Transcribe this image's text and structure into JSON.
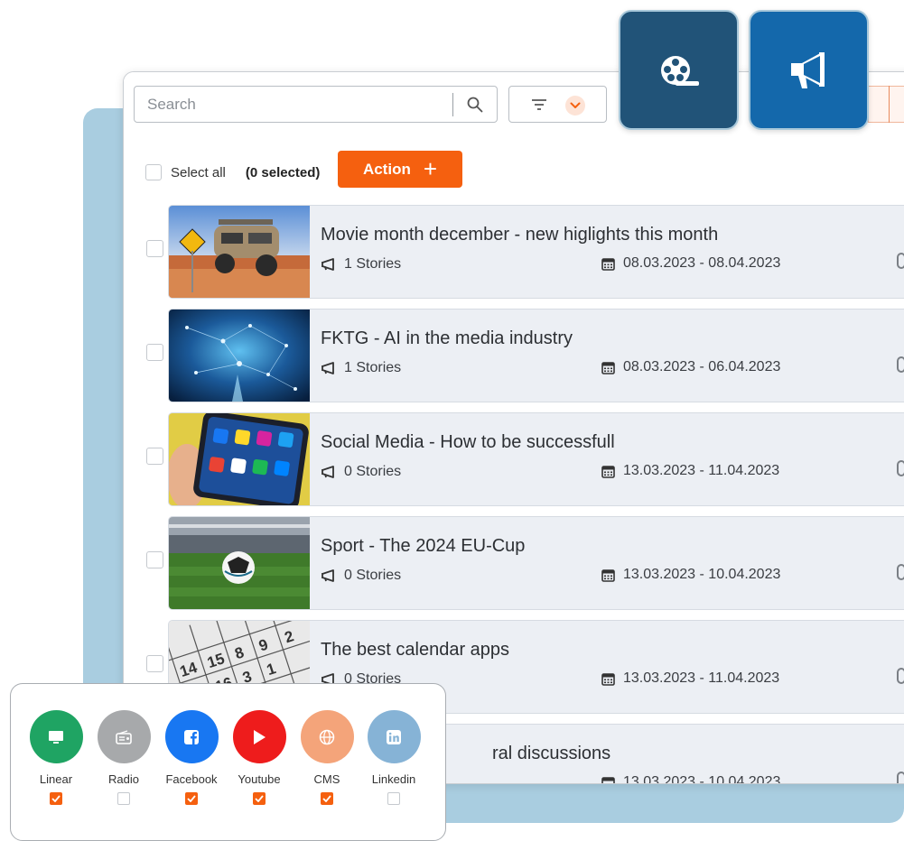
{
  "search": {
    "placeholder": "Search"
  },
  "selection": {
    "select_all_label": "Select all",
    "selected_count_text": "(0 selected)"
  },
  "action_button": {
    "label": "Action"
  },
  "big_buttons": [
    {
      "name": "film-button",
      "icon": "film-reel-icon",
      "color": "#215378"
    },
    {
      "name": "campaign-button",
      "icon": "megaphone-icon",
      "color": "#1468ab"
    }
  ],
  "items": [
    {
      "title": "Movie month december - new higlights this month",
      "stories": "1 Stories",
      "dates": "08.03.2023 - 08.04.2023",
      "thumb": "desert-vehicle"
    },
    {
      "title": "FKTG - AI in the media industry",
      "stories": "1 Stories",
      "dates": "08.03.2023 - 06.04.2023",
      "thumb": "ai-network"
    },
    {
      "title": "Social Media - How to be successfull",
      "stories": "0 Stories",
      "dates": "13.03.2023 - 11.04.2023",
      "thumb": "phone-apps"
    },
    {
      "title": "Sport - The 2024 EU-Cup",
      "stories": "0 Stories",
      "dates": "13.03.2023 - 10.04.2023",
      "thumb": "stadium-ball"
    },
    {
      "title": "The best calendar apps",
      "stories": "0 Stories",
      "dates": "13.03.2023 - 11.04.2023",
      "thumb": "calendar"
    },
    {
      "title": "ral discussions",
      "stories": "",
      "dates": "13.03.2023 - 10.04.2023",
      "thumb": ""
    }
  ],
  "channels": [
    {
      "label": "Linear",
      "icon": "monitor-icon",
      "color": "#1fa463",
      "checked": true
    },
    {
      "label": "Radio",
      "icon": "radio-icon",
      "color": "#a7a9ab",
      "checked": false
    },
    {
      "label": "Facebook",
      "icon": "facebook-icon",
      "color": "#1877f2",
      "checked": true
    },
    {
      "label": "Youtube",
      "icon": "youtube-icon",
      "color": "#ee1c1c",
      "checked": true
    },
    {
      "label": "CMS",
      "icon": "globe-icon",
      "color": "#f4a47a",
      "checked": true
    },
    {
      "label": "Linkedin",
      "icon": "linkedin-icon",
      "color": "#86b3d6",
      "checked": false
    }
  ],
  "colors": {
    "accent": "#f5600f",
    "card_bg": "#eceff4",
    "panel_bg": "#a9cde0"
  }
}
